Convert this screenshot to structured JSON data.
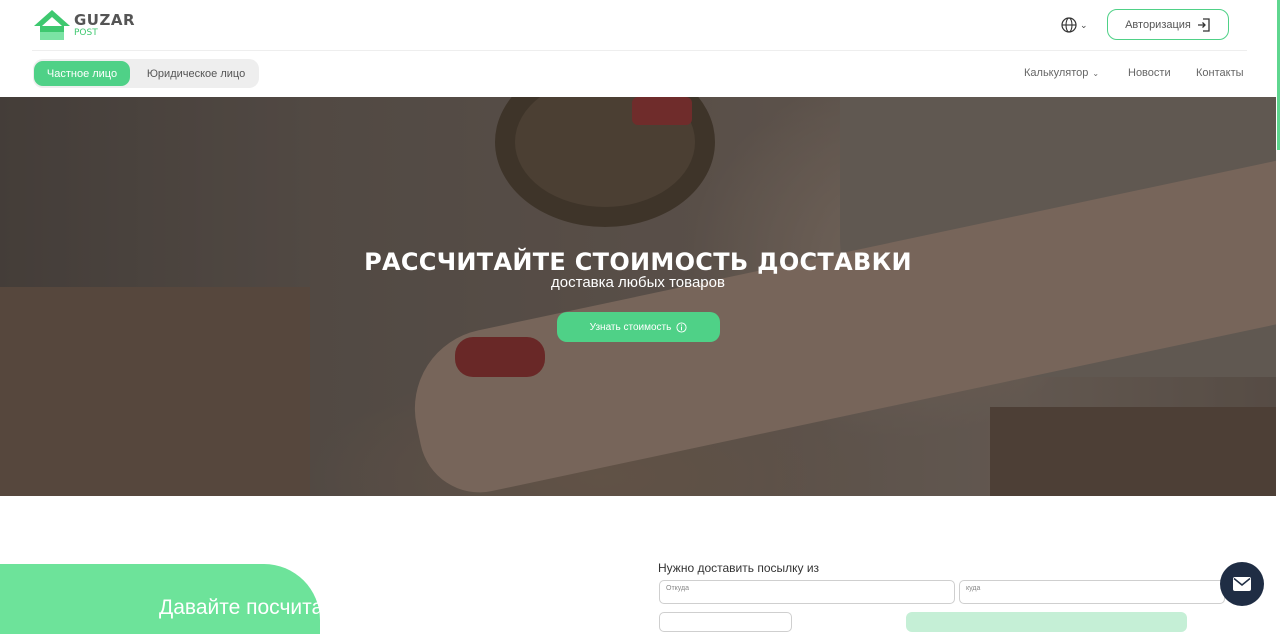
{
  "header": {
    "logo": {
      "name": "GUZAR",
      "sub": "POST"
    },
    "language_icon": "globe-icon",
    "auth_button": {
      "label": "Авторизация",
      "icon": "login-icon"
    }
  },
  "subnav": {
    "segments": [
      {
        "label": "Частное лицо",
        "active": true
      },
      {
        "label": "Юридическое лицо",
        "active": false
      }
    ],
    "links": {
      "calculator": "Калькулятор",
      "news": "Новости",
      "contacts": "Контакты"
    }
  },
  "hero": {
    "title": "РАССЧИТАЙТЕ СТОИМОСТЬ ДОСТАВКИ",
    "subtitle": "доставка любых товаров",
    "cta": {
      "label": "Узнать стоимость",
      "icon": "info-icon"
    }
  },
  "promo": {
    "title": "Давайте посчитаем"
  },
  "form": {
    "label": "Нужно доставить посылку из",
    "from_placeholder": "Откуда",
    "to_placeholder": "куда"
  },
  "chat": {
    "icon": "mail-icon"
  },
  "colors": {
    "accent": "#4fd187",
    "accent_light": "#6de39a",
    "chat_bg": "#1f2d44"
  }
}
